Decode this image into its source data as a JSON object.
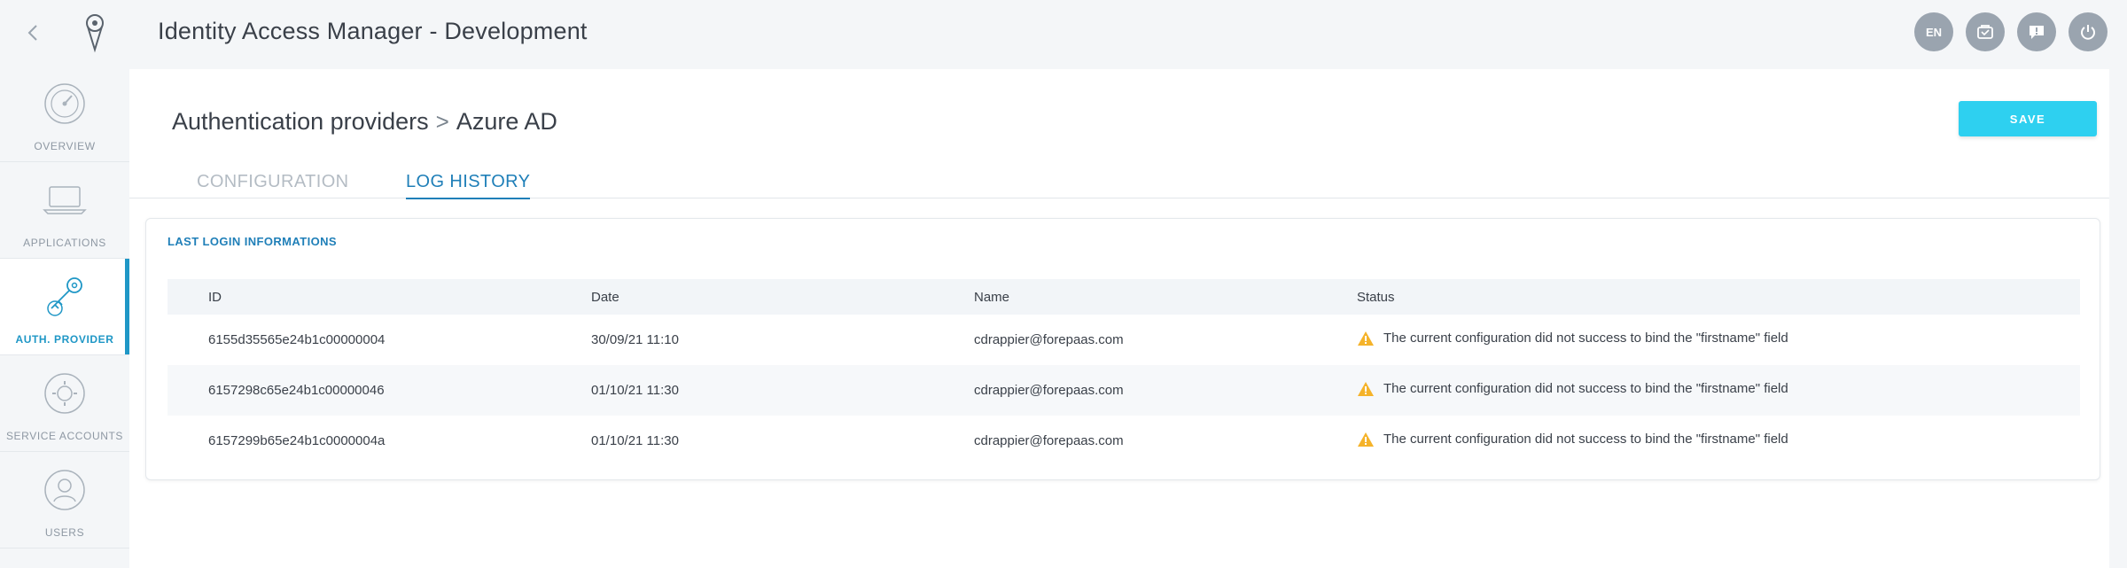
{
  "header": {
    "title": "Identity Access Manager - Development",
    "lang_label": "EN",
    "icons": [
      "back-icon",
      "logo-icon",
      "language-icon",
      "store-icon",
      "help-icon",
      "power-icon"
    ]
  },
  "sidebar": {
    "items": [
      {
        "label": "OVERVIEW",
        "icon": "dashboard-gauge-icon",
        "active": false
      },
      {
        "label": "APPLICATIONS",
        "icon": "laptop-icon",
        "active": false
      },
      {
        "label": "AUTH. PROVIDER",
        "icon": "key-icon",
        "active": true
      },
      {
        "label": "SERVICE ACCOUNTS",
        "icon": "service-account-icon",
        "active": false
      },
      {
        "label": "USERS",
        "icon": "user-icon",
        "active": false
      }
    ]
  },
  "main": {
    "breadcrumb": {
      "parent": "Authentication providers",
      "separator": ">",
      "current": "Azure AD"
    },
    "save_label": "SAVE",
    "tabs": [
      {
        "label": "CONFIGURATION",
        "active": false
      },
      {
        "label": "LOG HISTORY",
        "active": true
      }
    ],
    "card": {
      "title": "LAST LOGIN INFORMATIONS",
      "columns": [
        "ID",
        "Date",
        "Name",
        "Status"
      ],
      "rows": [
        {
          "id": "6155d35565e24b1c00000004",
          "date": "30/09/21 11:10",
          "name": "cdrappier@forepaas.com",
          "status": "The current configuration did not success to bind the \"firstname\" field"
        },
        {
          "id": "6157298c65e24b1c00000046",
          "date": "01/10/21 11:30",
          "name": "cdrappier@forepaas.com",
          "status": "The current configuration did not success to bind the \"firstname\" field"
        },
        {
          "id": "6157299b65e24b1c0000004a",
          "date": "01/10/21 11:30",
          "name": "cdrappier@forepaas.com",
          "status": "The current configuration did not success to bind the \"firstname\" field"
        }
      ]
    }
  },
  "colors": {
    "accent": "#1f97c6",
    "save_button": "#2ed0f0",
    "warning": "#f5b32a",
    "header_icon_bg": "#9aa4af"
  }
}
